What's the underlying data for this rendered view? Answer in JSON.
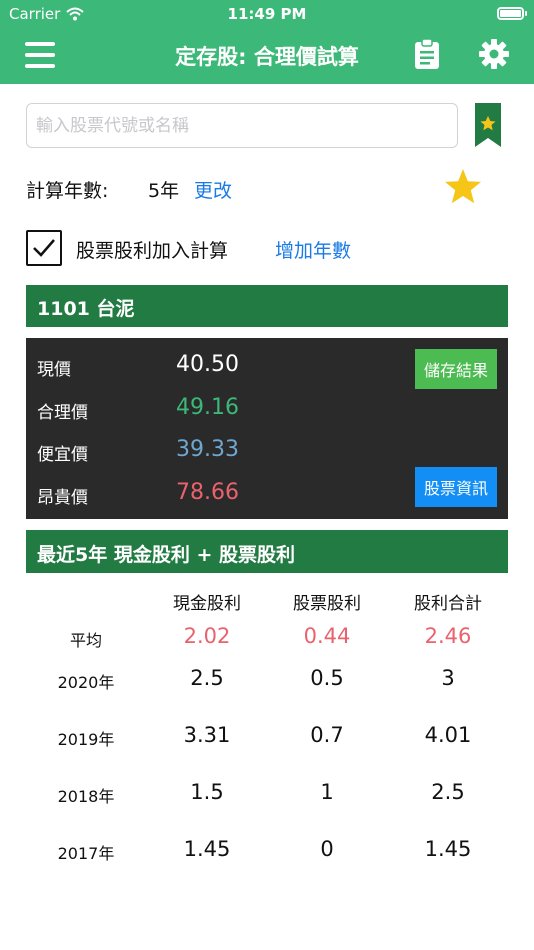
{
  "status": {
    "carrier": "Carrier",
    "time": "11:49 PM"
  },
  "nav": {
    "title": "定存股: 合理價試算"
  },
  "search": {
    "placeholder": "輸入股票代號或名稱"
  },
  "years": {
    "label": "計算年數:",
    "value": "5年",
    "change_label": "更改"
  },
  "include": {
    "checked": true,
    "label": "股票股利加入計算",
    "add_years_label": "增加年數"
  },
  "stock": {
    "title": "1101 台泥"
  },
  "prices": {
    "current_label": "現價",
    "current": "40.50",
    "fair_label": "合理價",
    "fair": "49.16",
    "cheap_label": "便宜價",
    "cheap": "39.33",
    "expensive_label": "昂貴價",
    "expensive": "78.66",
    "save_button": "儲存結果",
    "info_button": "股票資訊"
  },
  "dividends": {
    "title": "最近5年 現金股利 + 股票股利",
    "headers": [
      "現金股利",
      "股票股利",
      "股利合計"
    ],
    "avg_label": "平均",
    "avg": [
      "2.02",
      "0.44",
      "2.46"
    ],
    "rows": [
      {
        "year": "2020年",
        "values": [
          "2.5",
          "0.5",
          "3"
        ]
      },
      {
        "year": "2019年",
        "values": [
          "3.31",
          "0.7",
          "4.01"
        ]
      },
      {
        "year": "2018年",
        "values": [
          "1.5",
          "1",
          "2.5"
        ]
      },
      {
        "year": "2017年",
        "values": [
          "1.45",
          "0",
          "1.45"
        ]
      }
    ]
  },
  "colors": {
    "nav_green": "#3cb878",
    "header_green": "#237b44",
    "fair_green": "#3cb878",
    "cheap_blue": "#6ea7d0",
    "expensive_red": "#e9636e",
    "link_blue": "#1a7be6"
  },
  "icons": [
    "menu-icon",
    "clipboard-icon",
    "gear-icon",
    "bookmark-star-icon",
    "star-icon",
    "wifi-icon",
    "battery-icon",
    "checkmark-icon"
  ]
}
